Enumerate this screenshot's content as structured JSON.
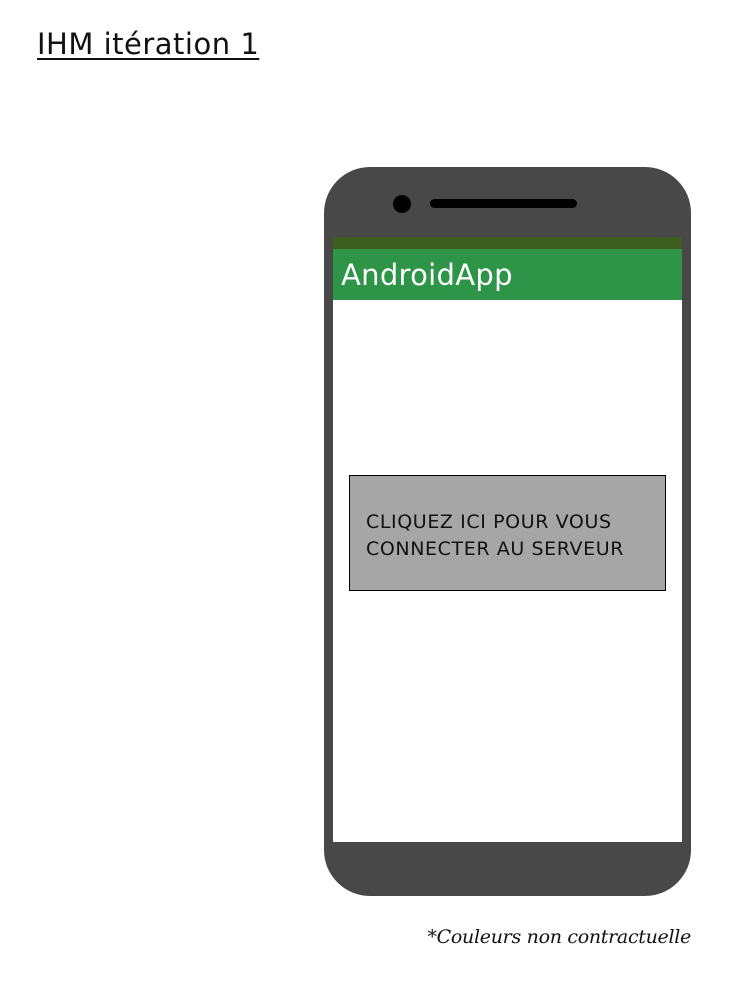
{
  "page": {
    "title": "IHM itération 1",
    "footnote": "*Couleurs non contractuelle"
  },
  "phone": {
    "colors": {
      "body": "#484848",
      "status_bar": "#3e5e22",
      "app_bar": "#2e9447",
      "button": "#a6a6a6"
    },
    "app_bar": {
      "title": "AndroidApp"
    },
    "connect_button": {
      "label": "CLIQUEZ ICI POUR VOUS CONNECTER AU SERVEUR"
    }
  }
}
